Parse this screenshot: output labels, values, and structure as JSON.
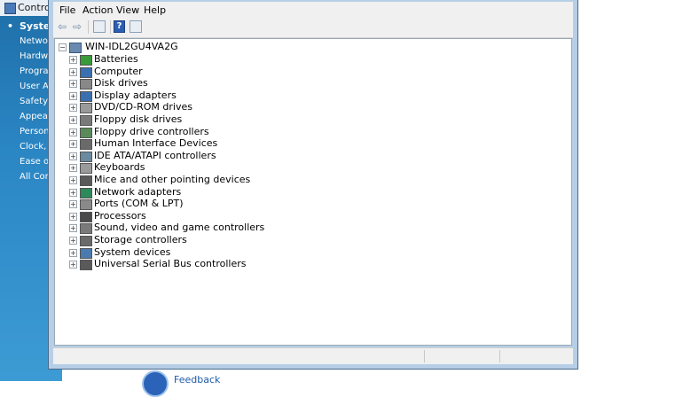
{
  "control_panel": {
    "title": "Control",
    "nav": [
      {
        "label": "System",
        "active": true
      },
      {
        "label": "Network"
      },
      {
        "label": "Hardwa"
      },
      {
        "label": "Program"
      },
      {
        "label": "User Acc"
      },
      {
        "label": "Safety"
      },
      {
        "label": "Appeara"
      },
      {
        "label": "Persona"
      },
      {
        "label": "Clock, L"
      },
      {
        "label": "Ease of A"
      },
      {
        "label": "All Cont"
      }
    ],
    "bullet": "•",
    "feedback": "Feedback"
  },
  "menu": {
    "file": "File",
    "action": "Action",
    "view": "View",
    "help": "Help"
  },
  "toolbar": {
    "back": "⇦",
    "forward": "⇨",
    "help_glyph": "?"
  },
  "tree": {
    "root": "WIN-IDL2GU4VA2G",
    "expand_glyph": "+",
    "collapse_glyph": "−",
    "items": [
      {
        "label": "Batteries",
        "icon": "battery-icon",
        "color": "#3a9a3a"
      },
      {
        "label": "Computer",
        "icon": "computer-icon",
        "color": "#3a6fb0"
      },
      {
        "label": "Disk drives",
        "icon": "disk-drive-icon",
        "color": "#888888"
      },
      {
        "label": "Display adapters",
        "icon": "display-adapter-icon",
        "color": "#3a6fb0"
      },
      {
        "label": "DVD/CD-ROM drives",
        "icon": "dvd-drive-icon",
        "color": "#9a9a9a"
      },
      {
        "label": "Floppy disk drives",
        "icon": "floppy-disk-icon",
        "color": "#7a7a7a"
      },
      {
        "label": "Floppy drive controllers",
        "icon": "floppy-controller-icon",
        "color": "#5a8a5a"
      },
      {
        "label": "Human Interface Devices",
        "icon": "hid-icon",
        "color": "#6a6a6a"
      },
      {
        "label": "IDE ATA/ATAPI controllers",
        "icon": "ide-controller-icon",
        "color": "#6a8aa0"
      },
      {
        "label": "Keyboards",
        "icon": "keyboard-icon",
        "color": "#9a9a9a"
      },
      {
        "label": "Mice and other pointing devices",
        "icon": "mouse-icon",
        "color": "#5a5a5a"
      },
      {
        "label": "Network adapters",
        "icon": "network-adapter-icon",
        "color": "#2e8a5a"
      },
      {
        "label": "Ports (COM & LPT)",
        "icon": "port-icon",
        "color": "#8a8a8a"
      },
      {
        "label": "Processors",
        "icon": "processor-icon",
        "color": "#4a4a4a"
      },
      {
        "label": "Sound, video and game controllers",
        "icon": "sound-icon",
        "color": "#7a7a7a"
      },
      {
        "label": "Storage controllers",
        "icon": "storage-controller-icon",
        "color": "#6a6a6a"
      },
      {
        "label": "System devices",
        "icon": "system-device-icon",
        "color": "#4a7ab0"
      },
      {
        "label": "Universal Serial Bus controllers",
        "icon": "usb-icon",
        "color": "#5a5a5a"
      }
    ]
  }
}
